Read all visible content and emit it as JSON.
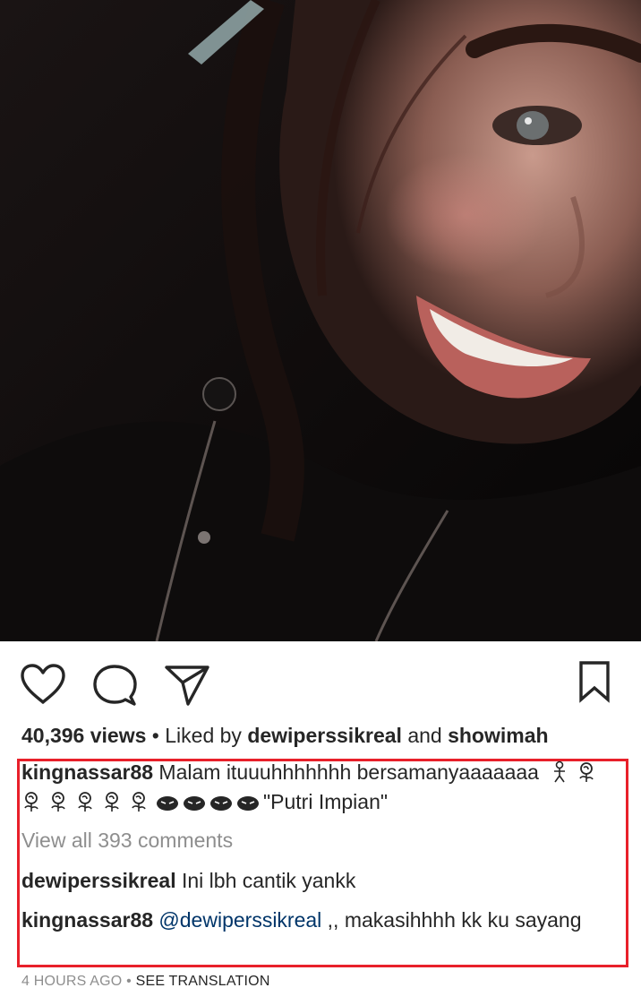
{
  "post": {
    "views_count": "40,396 views",
    "liked_by_prefix": "Liked by",
    "liked_by_user1": "dewiperssikreal",
    "liked_by_and": "and",
    "liked_by_user2": "showimah",
    "separator": "•"
  },
  "caption": {
    "username": "kingnassar88",
    "text_part1": "Malam ituuuhhhhhhh bersamanyaaaaaaa",
    "text_part2": "\"Putri Impian\"",
    "emoji_roses": 6,
    "emoji_faces": 4
  },
  "comments": {
    "view_all_label": "View all 393 comments",
    "items": [
      {
        "username": "dewiperssikreal",
        "text": "Ini lbh cantik yankk"
      },
      {
        "username": "kingnassar88",
        "mention": "@dewiperssikreal",
        "text": ",, makasihhhh kk ku sayang"
      }
    ]
  },
  "footer": {
    "timestamp": "4 HOURS AGO",
    "separator": "•",
    "see_translation": "SEE TRANSLATION"
  },
  "colors": {
    "highlight_border": "#e8202a",
    "text": "#262626",
    "muted": "#8e8e8e",
    "mention": "#003569"
  },
  "icons": {
    "like": "heart-icon",
    "comment": "comment-bubble-icon",
    "share": "paper-plane-icon",
    "save": "bookmark-icon"
  }
}
